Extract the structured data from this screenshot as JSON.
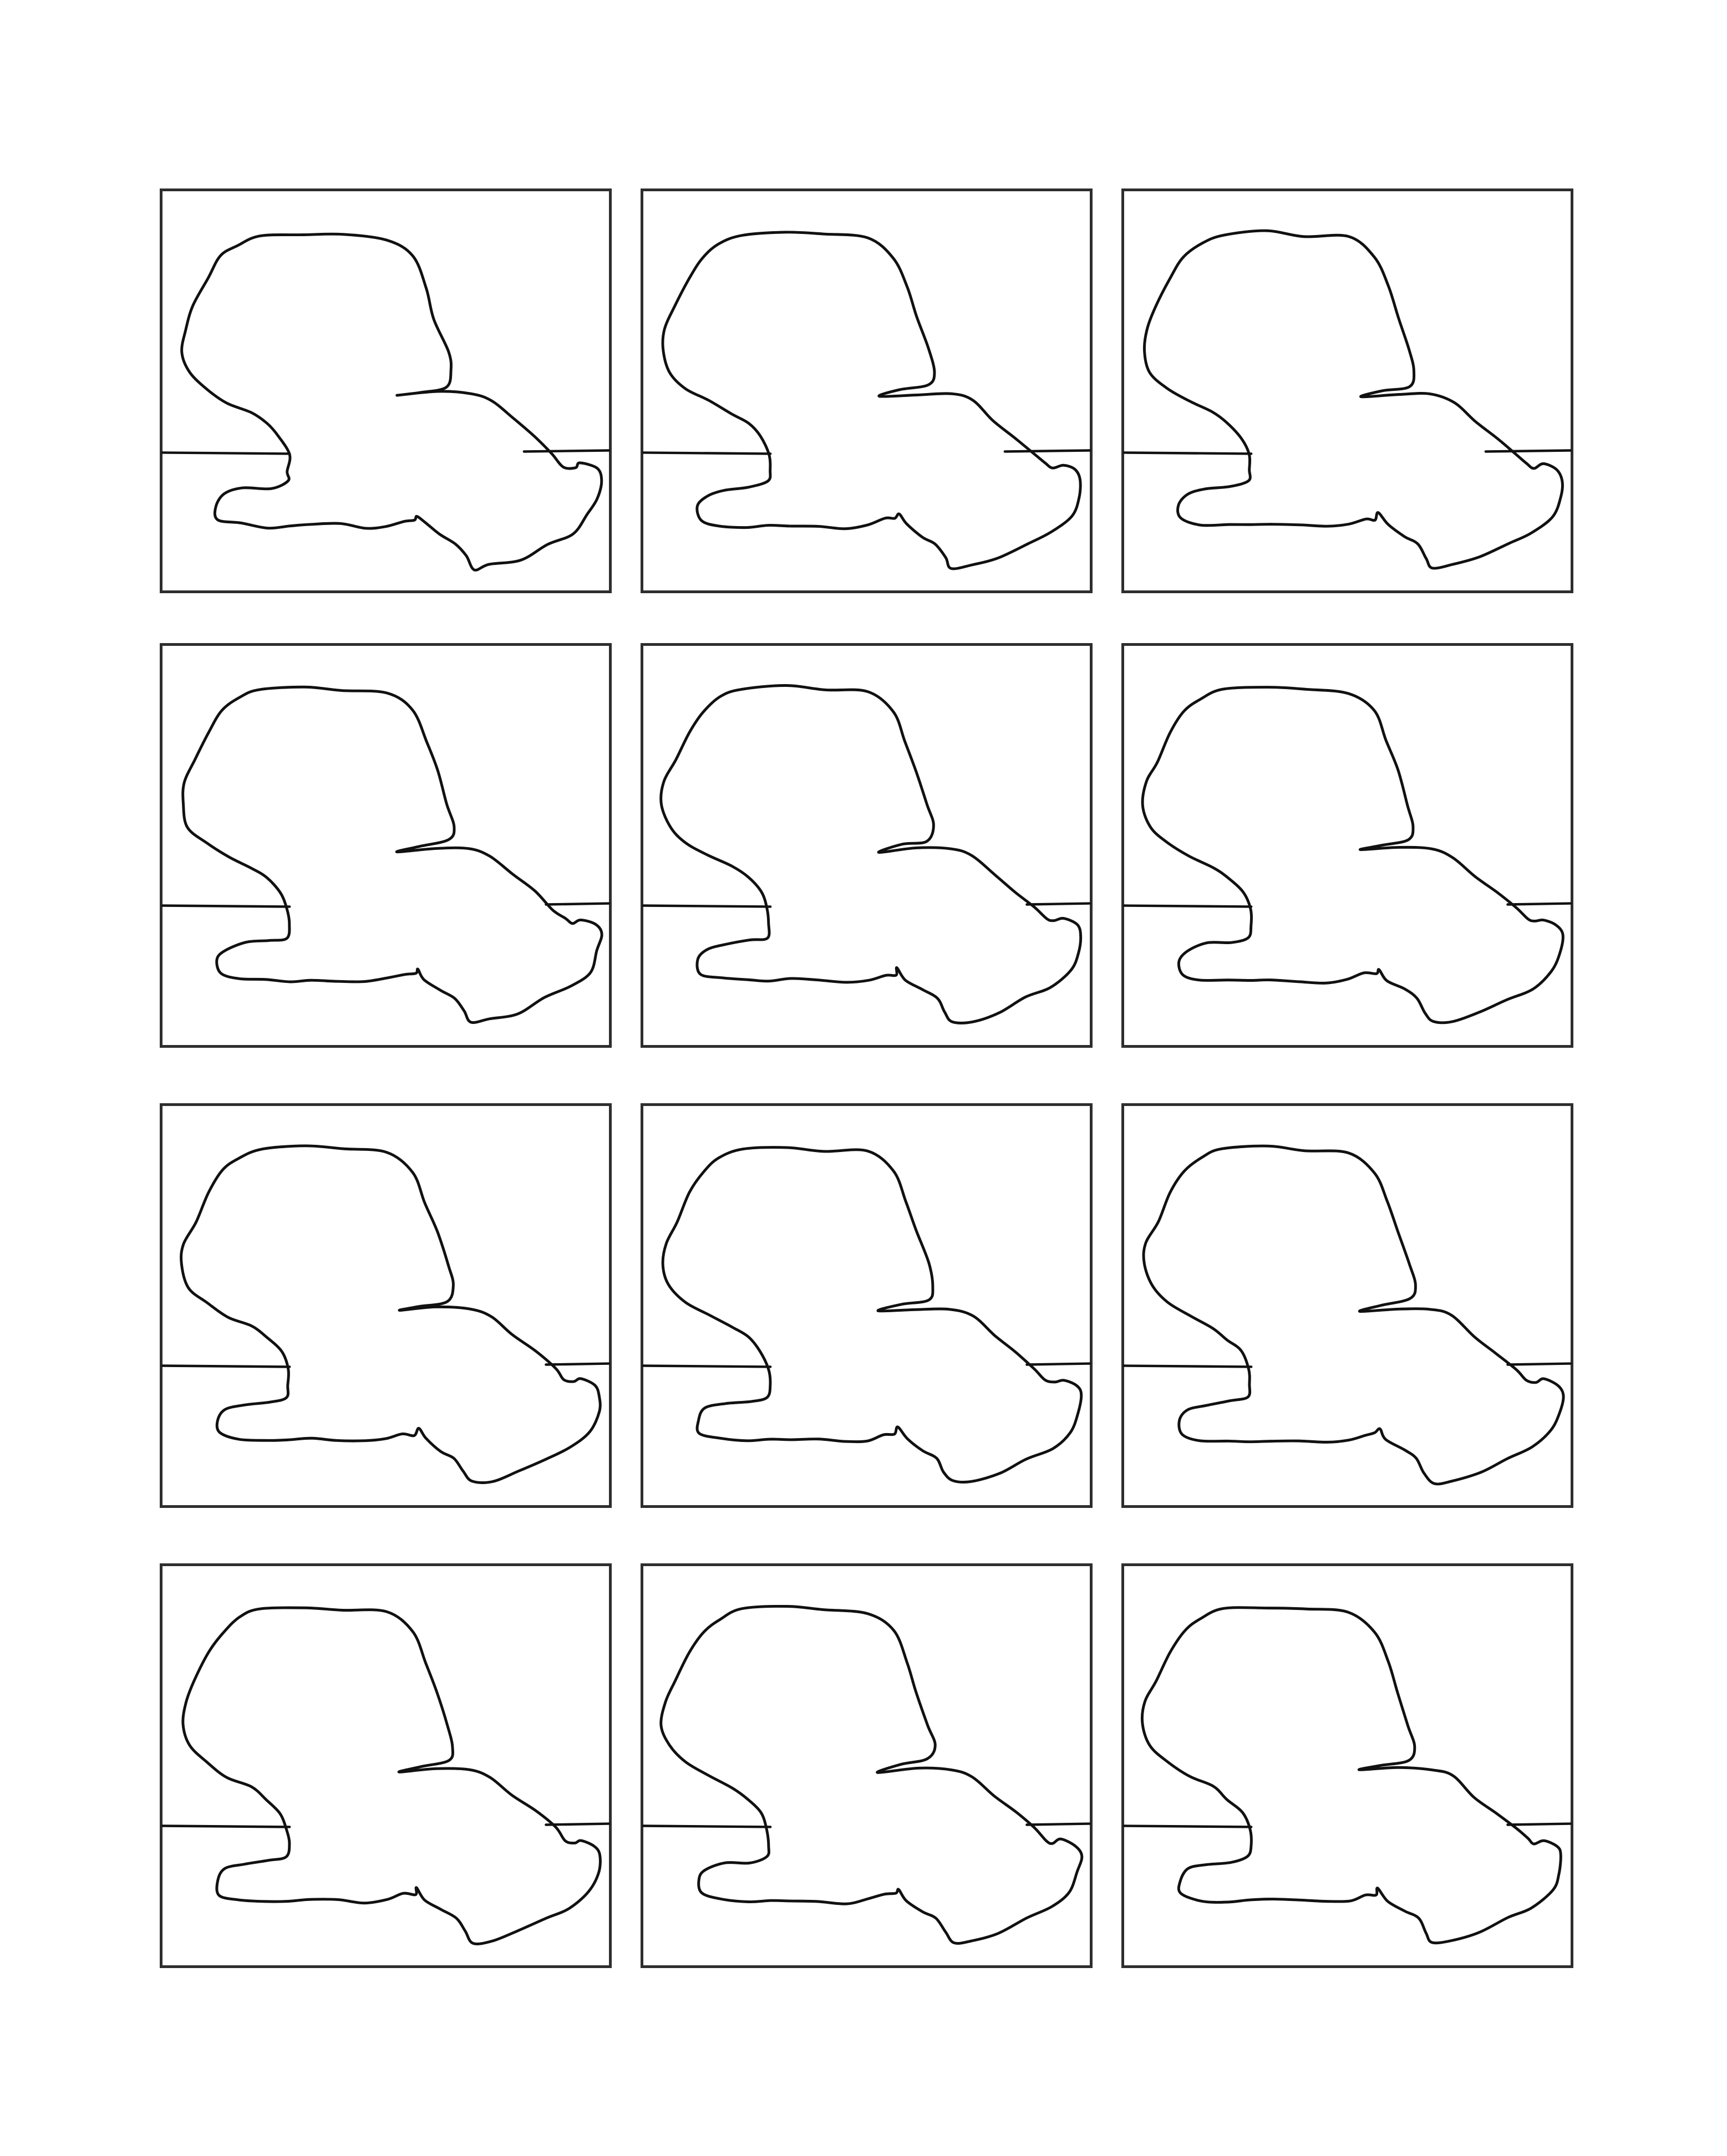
{
  "sheet": {
    "background_color": "#ffffff",
    "ink_color": "#111111",
    "frame_color": "#2e2e2e",
    "grid": {
      "rows": 4,
      "columns": 3
    }
  },
  "panels": [
    {
      "row": 1,
      "column": 1,
      "name": "panel-r1-c1"
    },
    {
      "row": 1,
      "column": 2,
      "name": "panel-r1-c2"
    },
    {
      "row": 1,
      "column": 3,
      "name": "panel-r1-c3"
    },
    {
      "row": 2,
      "column": 1,
      "name": "panel-r2-c1"
    },
    {
      "row": 2,
      "column": 2,
      "name": "panel-r2-c2"
    },
    {
      "row": 2,
      "column": 3,
      "name": "panel-r2-c3"
    },
    {
      "row": 3,
      "column": 1,
      "name": "panel-r3-c1"
    },
    {
      "row": 3,
      "column": 2,
      "name": "panel-r3-c2"
    },
    {
      "row": 3,
      "column": 3,
      "name": "panel-r3-c3"
    },
    {
      "row": 4,
      "column": 1,
      "name": "panel-r4-c1"
    },
    {
      "row": 4,
      "column": 2,
      "name": "panel-r4-c2"
    },
    {
      "row": 4,
      "column": 3,
      "name": "panel-r4-c3"
    }
  ]
}
